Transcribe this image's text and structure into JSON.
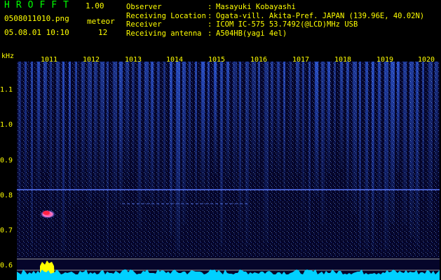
{
  "header": {
    "app_title": "HROFFT",
    "version": "1.00",
    "filename": "0508011010.png",
    "datetime": "05.08.01 10:10",
    "meteor_label": "meteor",
    "meteor_count": "12"
  },
  "info": [
    {
      "key": "Observer",
      "value": "Masayuki Kobayashi"
    },
    {
      "key": "Receiving Location",
      "value": "Ogata-vill. Akita-Pref. JAPAN (139.96E, 40.02N)"
    },
    {
      "key": "Receiver",
      "value": "ICOM IC-575 53.7492(@LCD)MHz USB"
    },
    {
      "key": "Receiving antenna",
      "value": "A504HB(yagi 4el)"
    }
  ],
  "axis": {
    "unit": "kHz",
    "y_labels": [
      "1.1",
      "1.0",
      "0.9",
      "0.8",
      "0.7",
      "0.6"
    ],
    "x_labels": [
      "1011",
      "1012",
      "1013",
      "1014",
      "1015",
      "1016",
      "1017",
      "1018",
      "1019",
      "1020"
    ]
  },
  "colors": {
    "label": "#ffff00",
    "title": "#00ff00",
    "background": "#05052a",
    "band": "#1a3aa0",
    "noise": "#00d0ff"
  }
}
